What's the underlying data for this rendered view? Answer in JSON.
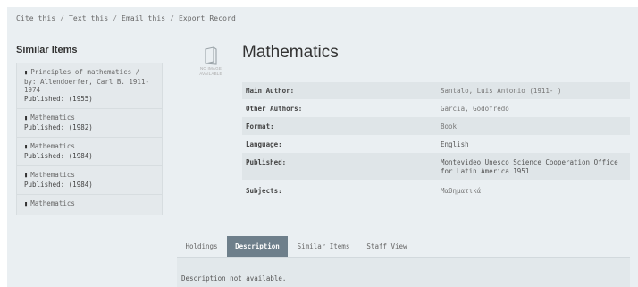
{
  "toolbar": {
    "cite": "Cite this",
    "text": "Text this",
    "email": "Email this",
    "export": "Export Record",
    "separator": "/"
  },
  "similar": {
    "heading": "Similar Items",
    "items": [
      {
        "title": "Principles of mathematics / by: Allendoerfer, Carl B. 1911-1974",
        "published": "Published: (1955)"
      },
      {
        "title": "Mathematics",
        "published": "Published: (1982)"
      },
      {
        "title": "Mathematics",
        "published": "Published: (1984)"
      },
      {
        "title": "Mathematics",
        "published": "Published: (1984)"
      },
      {
        "title": "Mathematics",
        "published": ""
      }
    ]
  },
  "cover": {
    "line1": "NO IMAGE",
    "line2": "AVAILABLE",
    "icon": "book-outline-icon"
  },
  "record": {
    "title": "Mathematics",
    "fields": [
      {
        "label": "Main Author:",
        "value": "Santalo, Luis Antonio (1911- )"
      },
      {
        "label": "Other Authors:",
        "value": "Garcia, Godofredo"
      },
      {
        "label": "Format:",
        "value": "Book"
      },
      {
        "label": "Language:",
        "value": "English"
      },
      {
        "label": "Published:",
        "value": "Montevideo Unesco Science Cooperation Office for Latin America 1951"
      },
      {
        "label": "Subjects:",
        "value": "Μαθηματικά"
      }
    ]
  },
  "tabs": {
    "items": [
      "Holdings",
      "Description",
      "Similar Items",
      "Staff View"
    ],
    "active": "Description"
  },
  "description": {
    "text": "Description not available."
  },
  "colors": {
    "panel_bg": "#eaeff2",
    "active_tab": "#6e7f8b",
    "row_shade": "#dfe5e8"
  }
}
